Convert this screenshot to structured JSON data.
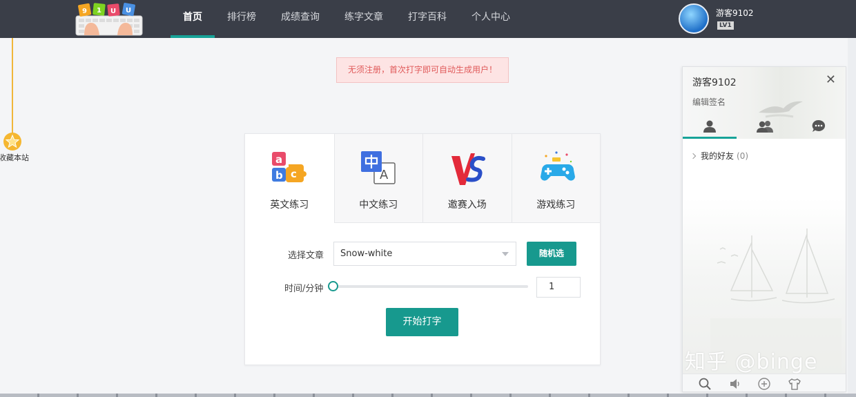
{
  "logo": {
    "letters": [
      "9",
      "1",
      "U",
      "U"
    ]
  },
  "nav": {
    "items": [
      {
        "label": "首页",
        "active": true
      },
      {
        "label": "排行榜",
        "active": false
      },
      {
        "label": "成绩查询",
        "active": false
      },
      {
        "label": "练字文章",
        "active": false
      },
      {
        "label": "打字百科",
        "active": false
      },
      {
        "label": "个人中心",
        "active": false
      }
    ]
  },
  "user": {
    "name": "游客9102",
    "level": "LV1"
  },
  "bookmark": {
    "label": "收藏本站"
  },
  "notice": {
    "text": "无须注册，首次打字即可自动生成用户！"
  },
  "practice": {
    "tabs": [
      {
        "label": "英文练习",
        "icon": "abc-blocks-icon",
        "active": true
      },
      {
        "label": "中文练习",
        "icon": "zh-en-icon",
        "active": false
      },
      {
        "label": "邀赛入场",
        "icon": "vs-icon",
        "active": false
      },
      {
        "label": "游戏练习",
        "icon": "gamepad-icon",
        "active": false
      }
    ],
    "article_label": "选择文章",
    "article_value": "Snow-white",
    "random_label": "随机选",
    "time_label": "时间/分钟",
    "time_value": "1",
    "slider_fraction": 0,
    "start_label": "开始打字"
  },
  "chat_panel": {
    "name": "游客9102",
    "signature": "编辑签名",
    "tabs": [
      "contact-icon",
      "group-icon",
      "chat-bubble-icon"
    ],
    "friends_label": "我的好友",
    "friends_count": "(0)",
    "watermark": "知乎 @binge",
    "footer_icons": [
      "search-icon",
      "volume-icon",
      "add-icon",
      "skin-icon"
    ]
  },
  "colors": {
    "accent": "#17998e",
    "nav_bg": "#3a3e48",
    "notice_text": "#e05a5a"
  }
}
